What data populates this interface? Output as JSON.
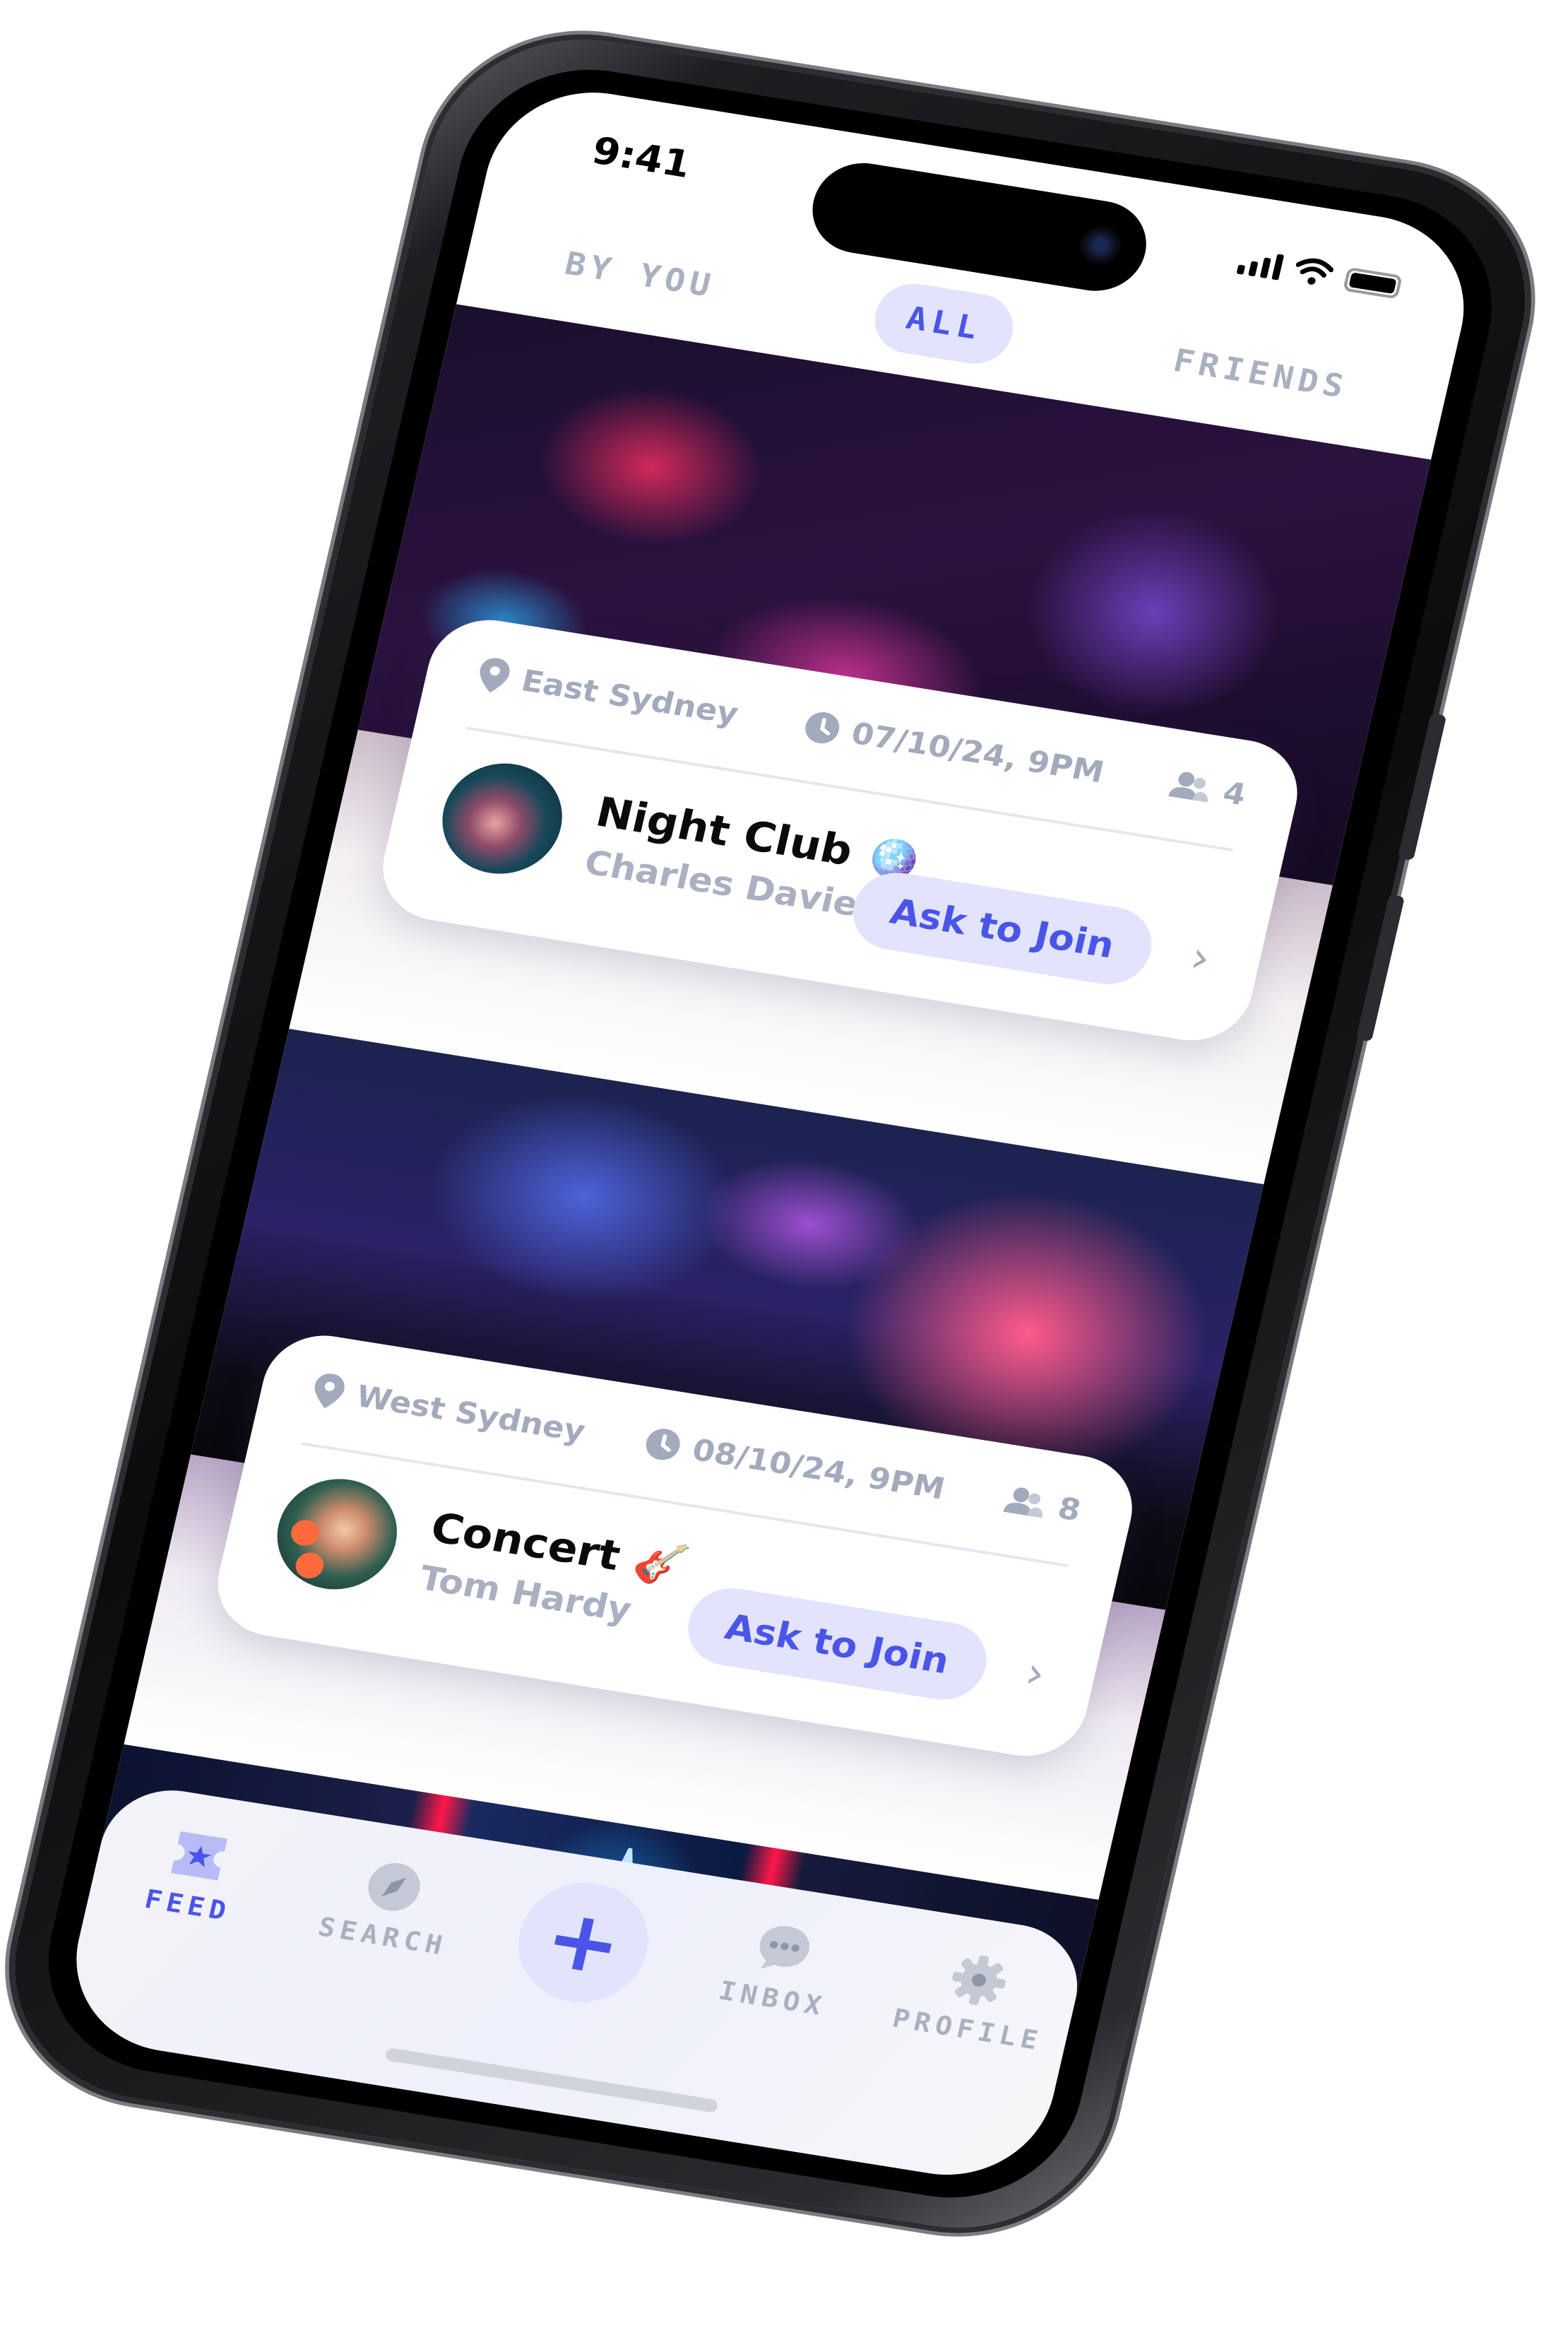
{
  "status_bar": {
    "time": "9:41",
    "icons": [
      "cellular-signal-icon",
      "wifi-icon",
      "battery-icon"
    ]
  },
  "filter_tabs": [
    {
      "label": "BY YOU",
      "active": false
    },
    {
      "label": "ALL",
      "active": true
    },
    {
      "label": "FRIENDS",
      "active": false
    }
  ],
  "events": [
    {
      "location": "East Sydney",
      "datetime": "07/10/24, 9PM",
      "attendees": "4",
      "title": "Night Club",
      "emoji": "🪩",
      "host": "Charles Davies",
      "action_label": "Ask to Join",
      "chevron": "›"
    },
    {
      "location": "West Sydney",
      "datetime": "08/10/24, 9PM",
      "attendees": "8",
      "title": "Concert",
      "emoji": "🎸",
      "host": "Tom Hardy",
      "action_label": "Ask to Join",
      "chevron": "›"
    }
  ],
  "tab_bar": {
    "items": [
      {
        "label": "FEED",
        "icon": "ticket-star-icon",
        "active": true
      },
      {
        "label": "SEARCH",
        "icon": "compass-icon",
        "active": false
      },
      {
        "label": "",
        "icon": "plus-icon",
        "active": false,
        "glyph": "+"
      },
      {
        "label": "INBOX",
        "icon": "chat-bubble-icon",
        "active": false
      },
      {
        "label": "PROFILE",
        "icon": "gear-icon",
        "active": false
      }
    ]
  },
  "colors": {
    "accent": "#4a55e8",
    "accent_bg": "#e2e3fc",
    "muted": "#a9b0c0"
  }
}
